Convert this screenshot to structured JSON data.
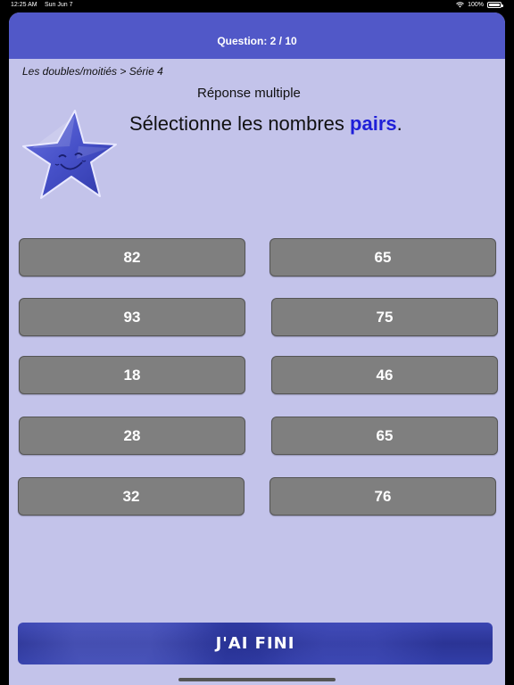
{
  "status_bar": {
    "time": "12:25 AM",
    "date": "Sun Jun 7",
    "battery": "100%"
  },
  "header": {
    "question": "Question: 2 / 10"
  },
  "breadcrumb": "Les doubles/moitiés > Série 4",
  "mode_label": "Réponse multiple",
  "instruction": {
    "prefix": "Sélectionne les nombres ",
    "highlight": "pairs",
    "suffix": "."
  },
  "answers": [
    "82",
    "65",
    "93",
    "75",
    "18",
    "46",
    "28",
    "65",
    "32",
    "76"
  ],
  "done_button": "J'AI FINI",
  "colors": {
    "background": "#c3c3ea",
    "header": "#5158c8",
    "answer_button": "#7f7f7f",
    "highlight": "#1f1fd8",
    "done_button": "#2f3a9f"
  },
  "icons": {
    "star": "smiling-star-icon",
    "wifi": "wifi-icon",
    "battery": "battery-icon"
  }
}
